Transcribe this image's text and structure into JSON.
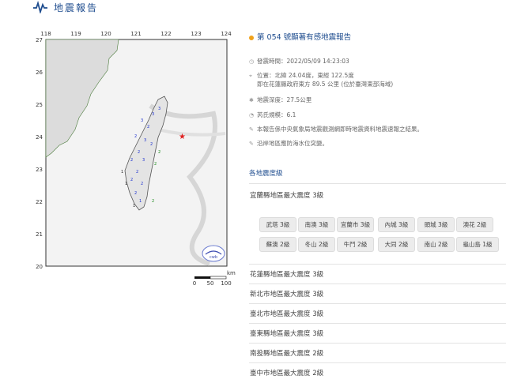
{
  "header": {
    "title": "地震報告"
  },
  "map": {
    "x_ticks": [
      "118",
      "119",
      "120",
      "121",
      "122",
      "123",
      "124"
    ],
    "y_ticks": [
      "27",
      "26",
      "25",
      "24",
      "23",
      "22",
      "21",
      "20"
    ],
    "scale_unit": "km",
    "scale_labels": [
      "0",
      "50",
      "100"
    ]
  },
  "report": {
    "title": "第 054 號顯著有感地震報告",
    "time_label": "發震時間：2022/05/09 14:23:03",
    "location_line1": "位置：北緯 24.04度，東經 122.5度",
    "location_line2": "即在花蓮縣政府東方 89.5 公里 (位於臺灣東部海域)",
    "depth_label": "地震深度：27.5公里",
    "magnitude_label": "芮氏規模：6.1",
    "note1": "本報告係中央氣象局地震觀測網即時地震資料地震速報之結果。",
    "note2": "沿岸地區應防海水位突變。"
  },
  "intensity": {
    "section_title": "各地震度級",
    "yilan_header": "宜蘭縣地區最大震度 3級",
    "yilan_stations": [
      "武塔 3級",
      "南澳 3級",
      "宜蘭市 3級",
      "內城 3級",
      "頭城 3級",
      "澳花 2級",
      "蘇澳 2級",
      "冬山 2級",
      "牛鬥 2級",
      "大同 2級",
      "南山 2級",
      "龜山島 1級"
    ],
    "regions": [
      "花蓮縣地區最大震度 3級",
      "新北市地區最大震度 3級",
      "臺北市地區最大震度 3級",
      "臺東縣地區最大震度 3級",
      "南投縣地區最大震度 2級",
      "臺中市地區最大震度 2級"
    ]
  },
  "colors": {
    "accent": "#1f4d8f",
    "bullet": "#f0a21b",
    "epicenter": "#e02020"
  },
  "icons": [
    "heartbeat-logo-icon",
    "clock-icon",
    "location-pin-icon",
    "depth-icon",
    "magnitude-icon",
    "info-icon",
    "warning-icon",
    "cwb-emblem-icon"
  ]
}
